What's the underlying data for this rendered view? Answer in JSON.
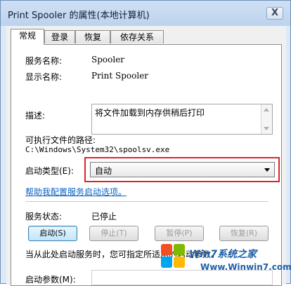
{
  "window": {
    "title": "Print Spooler 的属性(本地计算机)",
    "close_label": "X"
  },
  "tabs": [
    {
      "label": "常规",
      "active": true
    },
    {
      "label": "登录",
      "active": false
    },
    {
      "label": "恢复",
      "active": false
    },
    {
      "label": "依存关系",
      "active": false
    }
  ],
  "general": {
    "service_name_label": "服务名称:",
    "service_name_value": "Spooler",
    "display_name_label": "显示名称:",
    "display_name_value": "Print Spooler",
    "description_label": "描述:",
    "description_value": "将文件加载到内存供稍后打印",
    "exe_path_label": "可执行文件的路径:",
    "exe_path_value": "C:\\Windows\\System32\\spoolsv.exe",
    "startup_type_label": "启动类型(E):",
    "startup_type_value": "自动",
    "help_link": "帮助我配置服务启动选项。",
    "service_status_label": "服务状态:",
    "service_status_value": "已停止",
    "buttons": {
      "start": "启动(S)",
      "stop": "停止(T)",
      "pause": "暂停(P)",
      "resume": "恢复(R)"
    },
    "hint": "当从此处启动服务时，您可指定所适用的启动参数。",
    "start_params_label": "启动参数(M):",
    "start_params_value": ""
  },
  "watermark": {
    "brand": "Win7系统之家",
    "url": "Www.Winwin7.com"
  },
  "colors": {
    "highlight_border": "#d9262b",
    "link": "#0b61c4",
    "watermark": "#1e5fa8"
  }
}
